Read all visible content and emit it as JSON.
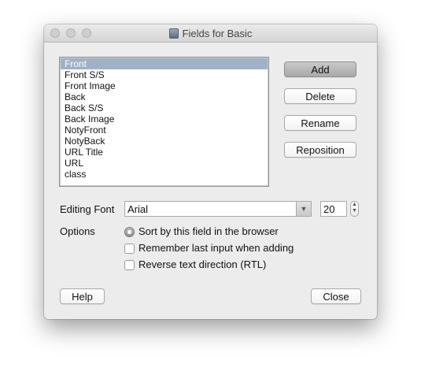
{
  "window": {
    "title": "Fields for Basic",
    "app_icon": "anki-icon"
  },
  "fields": {
    "items": [
      "Front",
      "Front S/S",
      "Front Image",
      "Back",
      "Back S/S",
      "Back Image",
      "NotyFront",
      "NotyBack",
      "URL Title",
      "URL",
      "class"
    ],
    "selected": "Front"
  },
  "buttons": {
    "add": "Add",
    "delete": "Delete",
    "rename": "Rename",
    "reposition": "Reposition",
    "help": "Help",
    "close": "Close"
  },
  "editing_font": {
    "label": "Editing Font",
    "font": "Arial",
    "size": "20"
  },
  "options": {
    "label": "Options",
    "sort_by_field": "Sort by this field in the browser",
    "remember_last_input": "Remember last input when adding",
    "rtl": "Reverse text direction (RTL)",
    "sort_by_field_selected": true,
    "remember_last_input_checked": false,
    "rtl_checked": false
  }
}
